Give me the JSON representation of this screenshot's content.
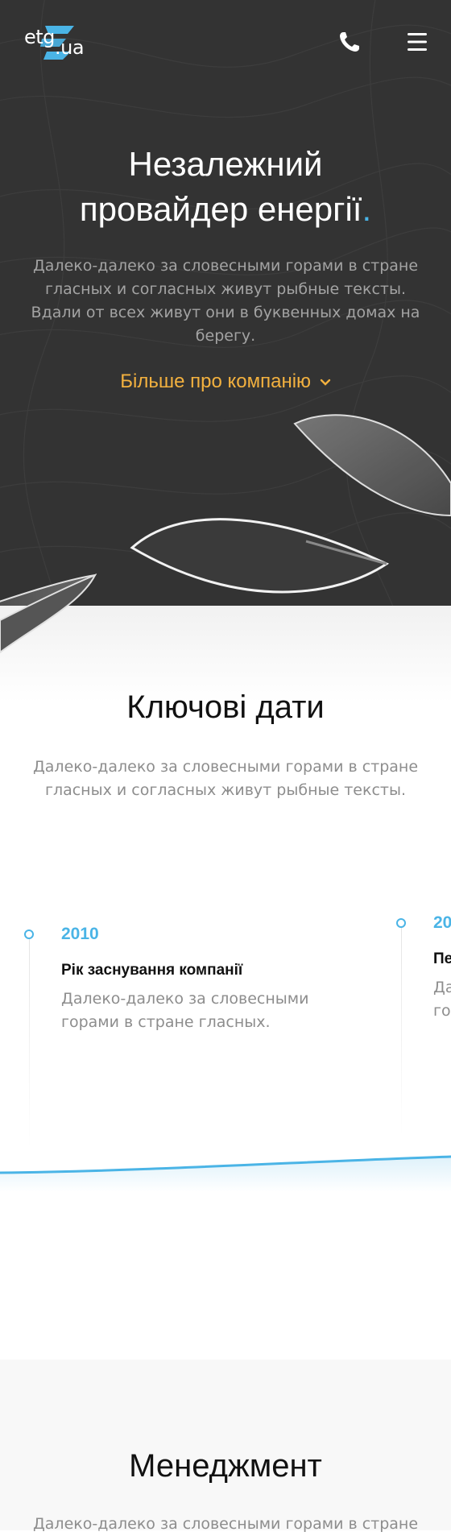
{
  "header": {
    "logo_main": "etg",
    "logo_suffix": ".ua"
  },
  "hero": {
    "title_line1": "Незалежний",
    "title_line2": "провайдер енергії",
    "title_dot": ".",
    "description": "Далеко-далеко за словесными горами в стране гласных и согласных живут рыбные тексты. Вдали от всех живут они в буквенных домах на берегу.",
    "more_link": "Більше про компанію"
  },
  "dates": {
    "title": "Ключові дати",
    "description": "Далеко-далеко за словесными горами в стране гласных и согласных живут рыбные тексты.",
    "items": [
      {
        "year": "2010",
        "heading": "Рік заснування компанії",
        "text": "Далеко-далеко за словесными горами в стране гласных."
      },
      {
        "year": "20",
        "heading": "Пе",
        "text": "Да го"
      }
    ]
  },
  "management": {
    "title": "Менеджмент",
    "description": "Далеко-далеко за словесными горами в стране"
  },
  "colors": {
    "hero_bg": "#333333",
    "accent_blue": "#4ab4e6",
    "accent_orange": "#f3b13f"
  },
  "icons": {
    "phone": "phone-icon",
    "menu": "hamburger-menu-icon",
    "chevron": "chevron-down-icon"
  }
}
